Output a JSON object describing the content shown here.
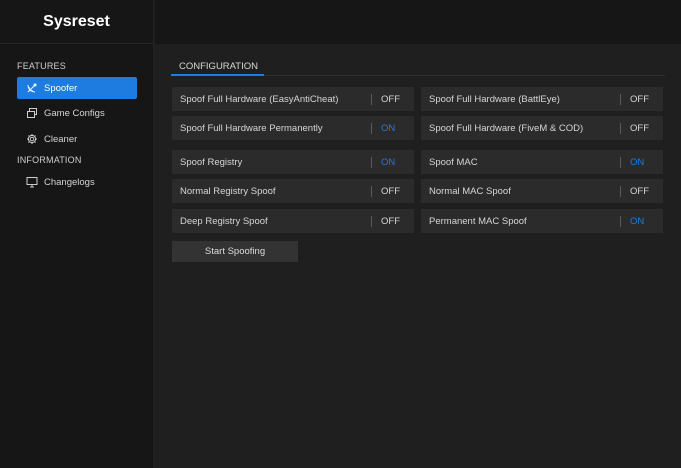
{
  "app": {
    "title": "Sysreset"
  },
  "sidebar": {
    "features_label": "FEATURES",
    "information_label": "INFORMATION",
    "items": [
      {
        "label": "Spoofer",
        "icon": "satellite-dish-icon",
        "active": true
      },
      {
        "label": "Game Configs",
        "icon": "stacked-windows-icon",
        "active": false
      },
      {
        "label": "Cleaner",
        "icon": "gear-icon",
        "active": false
      },
      {
        "label": "Changelogs",
        "icon": "monitor-icon",
        "active": false
      }
    ]
  },
  "main": {
    "tab": "CONFIGURATION",
    "options": [
      {
        "label": "Spoof Full Hardware (EasyAntiCheat)",
        "value": "OFF"
      },
      {
        "label": "Spoof Full Hardware (BattlEye)",
        "value": "OFF"
      },
      {
        "label": "Spoof Full Hardware Permanently",
        "value": "ON"
      },
      {
        "label": "Spoof Full Hardware (FiveM & COD)",
        "value": "OFF"
      },
      {
        "label": "Spoof Registry",
        "value": "ON"
      },
      {
        "label": "Spoof MAC",
        "value": "ON"
      },
      {
        "label": "Normal Registry Spoof",
        "value": "OFF"
      },
      {
        "label": "Normal MAC Spoof",
        "value": "OFF"
      },
      {
        "label": "Deep Registry Spoof",
        "value": "OFF"
      },
      {
        "label": "Permanent MAC Spoof",
        "value": "ON"
      }
    ],
    "start_button": "Start Spoofing"
  },
  "colors": {
    "accent": "#1e7be0",
    "sidebar_bg": "#161616",
    "main_bg": "#1f1f1f",
    "row_bg": "#2b2b2b"
  }
}
